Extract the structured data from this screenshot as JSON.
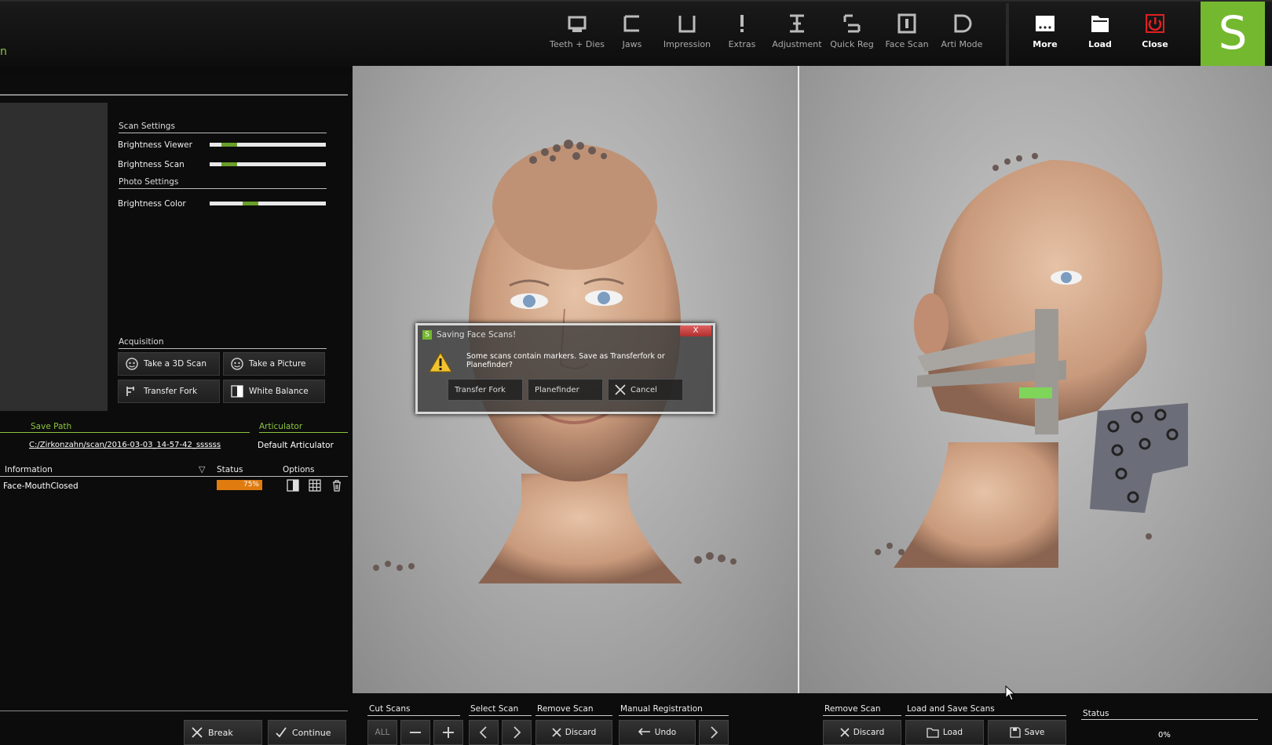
{
  "app": {
    "title_fragment": "n"
  },
  "toolbar": {
    "items": [
      {
        "label": "Teeth + Dies",
        "icon": "teeth-dies-icon"
      },
      {
        "label": "Jaws",
        "icon": "jaws-icon"
      },
      {
        "label": "Impression",
        "icon": "impression-icon"
      },
      {
        "label": "Extras",
        "icon": "extras-icon"
      },
      {
        "label": "Adjustment",
        "icon": "adjustment-icon"
      },
      {
        "label": "Quick Reg",
        "icon": "quick-reg-icon"
      },
      {
        "label": "Face Scan",
        "icon": "face-scan-icon"
      },
      {
        "label": "Arti Mode",
        "icon": "arti-mode-icon"
      }
    ],
    "right": [
      {
        "label": "More",
        "icon": "more-icon"
      },
      {
        "label": "Load",
        "icon": "load-icon"
      },
      {
        "label": "Close",
        "icon": "power-icon"
      }
    ],
    "logo": "S",
    "accent": "#74b82f"
  },
  "scan_settings": {
    "title": "Scan Settings",
    "brightness_viewer": {
      "label": "Brightness Viewer",
      "level": 0.12
    },
    "brightness_scan": {
      "label": "Brightness Scan",
      "level": 0.12
    },
    "photo_title": "Photo Settings",
    "brightness_color": {
      "label": "Brightness Color",
      "level": 0.33
    }
  },
  "acquisition": {
    "title": "Acquisition",
    "take_3d_scan": "Take a 3D Scan",
    "take_picture": "Take a Picture",
    "transfer_fork": "Transfer Fork",
    "white_balance": "White Balance"
  },
  "save_path": {
    "title": "Save Path",
    "value": "C:/Zirkonzahn/scan/2016-03-03_14-57-42_ssssss"
  },
  "articulator": {
    "title": "Articulator",
    "value": "Default Articulator"
  },
  "table": {
    "headers": {
      "information": "Information",
      "status": "Status",
      "options": "Options"
    },
    "rows": [
      {
        "name": "Face-MouthClosed",
        "status": "75%"
      }
    ]
  },
  "footer": {
    "break": "Break",
    "continue": "Continue"
  },
  "dialog": {
    "title": "Saving Face Scans!",
    "close": "X",
    "message": "Some scans contain markers. Save as Transferfork or Planefinder?",
    "transfer_fork": "Transfer Fork",
    "planefinder": "Planefinder",
    "cancel": "Cancel"
  },
  "bottom": {
    "cut_scans": "Cut Scans",
    "select_scan": "Select Scan",
    "remove_scan": "Remove Scan",
    "manual_registration": "Manual Registration",
    "remove_scan_2": "Remove Scan",
    "load_save": "Load  and Save Scans",
    "status": "Status",
    "all": "ALL",
    "discard": "Discard",
    "undo": "Undo",
    "discard_2": "Discard",
    "load": "Load",
    "save": "Save",
    "status_value": "0%"
  }
}
